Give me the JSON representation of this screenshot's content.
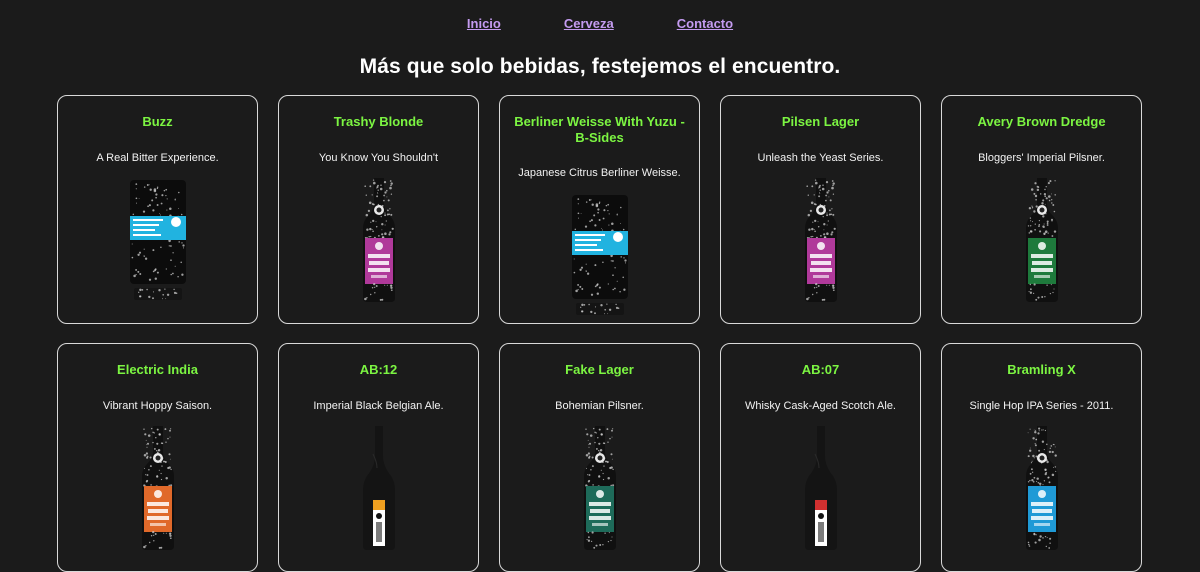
{
  "nav": {
    "inicio": "Inicio",
    "cerveza": "Cerveza",
    "contacto": "Contacto"
  },
  "headline": "Más que solo bebidas, festejemos el encuentro.",
  "colors": {
    "background": "#1b1b1b",
    "nav_link": "#c49bf0",
    "beer_name": "#7cf542",
    "card_border": "#d9d9d9"
  },
  "beers": [
    {
      "name": "Buzz",
      "tagline": "A Real Bitter Experience.",
      "image": "can-icon",
      "label_color": "#21b3e0",
      "label_text": "CRAFT BEER FOR THE PEOPLE"
    },
    {
      "name": "Trashy Blonde",
      "tagline": "You Know You Shouldn't",
      "image": "bottle-icon",
      "label_color": "#b0399a",
      "label_text": "TRASHY BLONDE"
    },
    {
      "name": "Berliner Weisse With Yuzu - B-Sides",
      "tagline": "Japanese Citrus Berliner Weisse.",
      "image": "can-icon",
      "label_color": "#21b3e0",
      "label_text": "CRAFT BEER FOR THE PEOPLE"
    },
    {
      "name": "Pilsen Lager",
      "tagline": "Unleash the Yeast Series.",
      "image": "bottle-icon",
      "label_color": "#b0399a",
      "label_text": "PILSEN LAGER"
    },
    {
      "name": "Avery Brown Dredge",
      "tagline": "Bloggers' Imperial Pilsner.",
      "image": "bottle-icon",
      "label_color": "#1e7a3c",
      "label_text": "AVERY BROWN DREDGE"
    },
    {
      "name": "Electric India",
      "tagline": "Vibrant Hoppy Saison.",
      "image": "bottle-icon",
      "label_color": "#e0692a",
      "label_text": "ELECTRIC INDIA"
    },
    {
      "name": "AB:12",
      "tagline": "Imperial Black Belgian Ale.",
      "image": "wine-bottle-icon",
      "label_color": "#f0a020",
      "label_text": "AB:12"
    },
    {
      "name": "Fake Lager",
      "tagline": "Bohemian Pilsner.",
      "image": "bottle-icon",
      "label_color": "#1e6b5a",
      "label_text": "FAKE LAGER"
    },
    {
      "name": "AB:07",
      "tagline": "Whisky Cask-Aged Scotch Ale.",
      "image": "wine-bottle-icon",
      "label_color": "#d23030",
      "label_text": "AB:07"
    },
    {
      "name": "Bramling X",
      "tagline": "Single Hop IPA Series - 2011.",
      "image": "bottle-icon",
      "label_color": "#1f9ad6",
      "label_text": "BRAMLING X"
    }
  ]
}
